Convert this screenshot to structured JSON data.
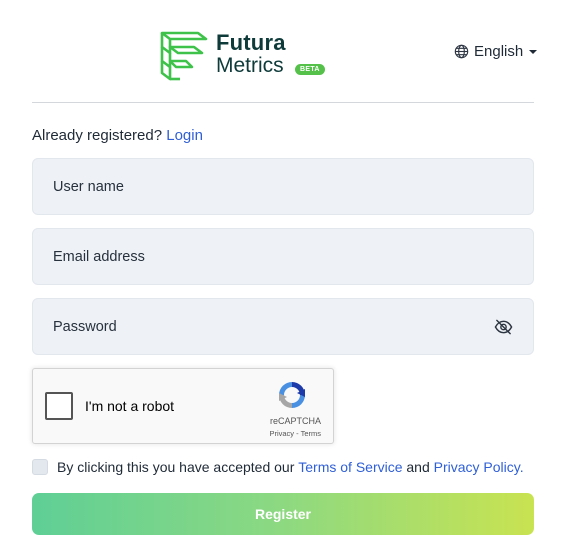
{
  "header": {
    "logo_word1": "Futura",
    "logo_word2": "Metrics",
    "badge": "BETA",
    "language": "English",
    "language_icon": "globe-icon",
    "caret_icon": "chevron-down-icon"
  },
  "login_prompt": {
    "text": "Already registered?",
    "link": "Login"
  },
  "form": {
    "username": {
      "placeholder": "User name",
      "value": ""
    },
    "email": {
      "placeholder": "Email address",
      "value": ""
    },
    "password": {
      "placeholder": "Password",
      "value": "",
      "toggle_icon": "eye-off-icon"
    }
  },
  "recaptcha": {
    "label": "I'm not a robot",
    "brand": "reCAPTCHA",
    "privacy": "Privacy",
    "separator": "-",
    "terms": "Terms"
  },
  "agreement": {
    "prefix": "By clicking this you have accepted our",
    "terms_link": "Terms of Service",
    "conjunction": "and",
    "privacy_link": "Privacy Policy",
    "suffix": "."
  },
  "register_button": "Register",
  "colors": {
    "link": "#2f5fd6",
    "brand_dark": "#0e3b3a",
    "brand_green": "#55c14a",
    "button_gradient_start": "#5fcf96",
    "button_gradient_end": "#c9e351",
    "field_bg": "#eef2f6"
  }
}
